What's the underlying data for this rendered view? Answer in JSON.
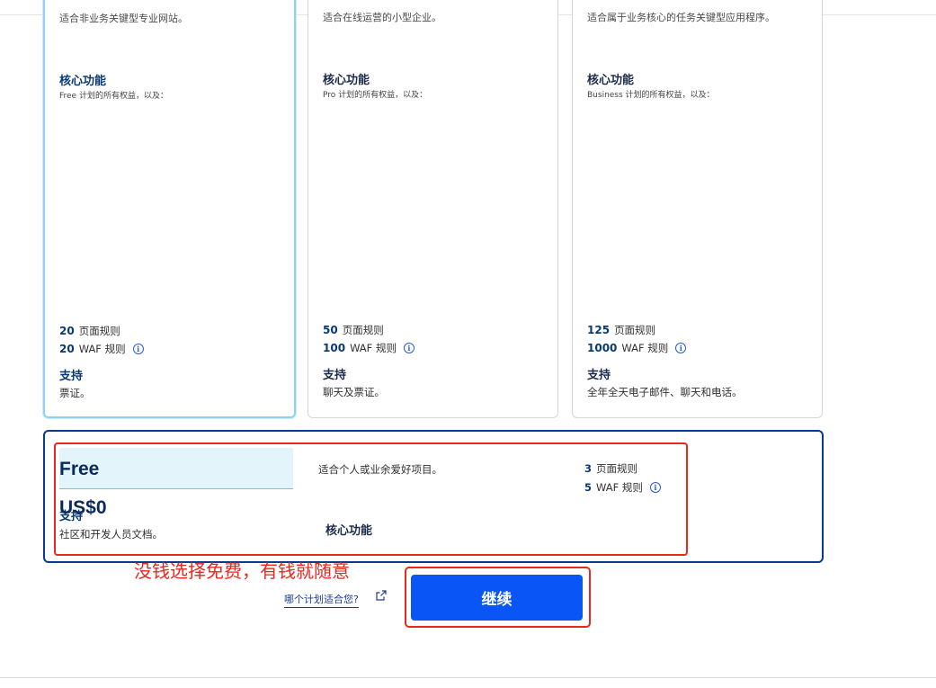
{
  "plans": [
    {
      "id": "free",
      "description": "适合非业务关键型专业网站。",
      "features_title": "核心功能",
      "features_sub": "Free 计划的所有权益，以及：",
      "page_rules_count": "20",
      "page_rules_label": "页面规则",
      "waf_rules_count": "20",
      "waf_rules_label": "WAF 规则",
      "support_title": "支持",
      "support_text": "票证。"
    },
    {
      "id": "pro",
      "description": "适合在线运营的小型企业。",
      "features_title": "核心功能",
      "features_sub": "Pro 计划的所有权益，以及：",
      "page_rules_count": "50",
      "page_rules_label": "页面规则",
      "waf_rules_count": "100",
      "waf_rules_label": "WAF 规则",
      "support_title": "支持",
      "support_text": "聊天及票证。"
    },
    {
      "id": "business",
      "description": "适合属于业务核心的任务关键型应用程序。",
      "features_title": "核心功能",
      "features_sub": "Business 计划的所有权益，以及：",
      "page_rules_count": "125",
      "page_rules_label": "页面规则",
      "waf_rules_count": "1000",
      "waf_rules_label": "WAF 规则",
      "support_title": "支持",
      "support_text": "全年全天电子邮件、聊天和电话。"
    }
  ],
  "free_plan": {
    "name": "Free",
    "price": "US$0",
    "support_label": "支持",
    "support_text": "社区和开发人员文档。",
    "description": "适合个人或业余爱好项目。",
    "features_title": "核心功能",
    "page_rules_count": "3",
    "page_rules_label": "页面规则",
    "waf_rules_count": "5",
    "waf_rules_label": "WAF 规则"
  },
  "annotation": {
    "text": "没钱选择免费，有钱就随意",
    "color": "#e8281e"
  },
  "footer": {
    "which_plan_link": "哪个计划适合您?",
    "continue_button": "继续"
  },
  "colors": {
    "accent": "#0a55f5",
    "selected_border": "#8fd3f2",
    "free_card_border": "#0a3a8c"
  }
}
